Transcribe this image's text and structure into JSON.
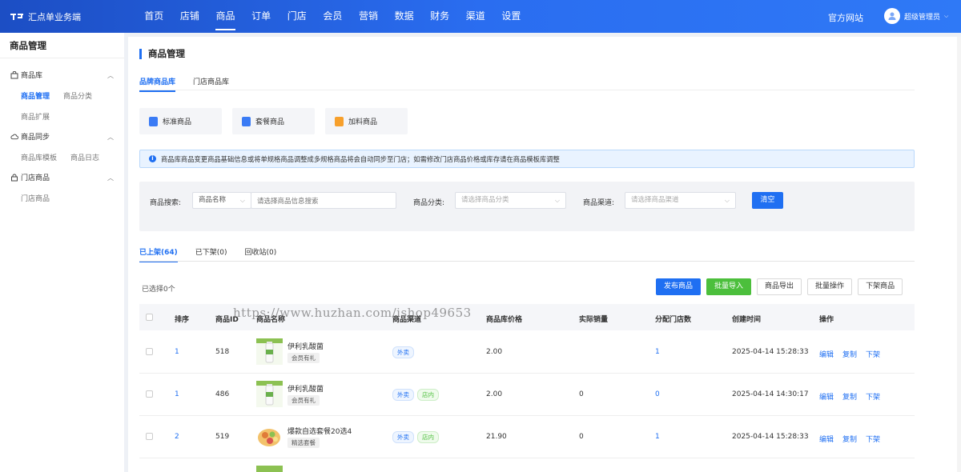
{
  "header": {
    "logo_text": "汇点单业务端",
    "nav": [
      "首页",
      "店铺",
      "商品",
      "订单",
      "门店",
      "会员",
      "营销",
      "数据",
      "财务",
      "渠道",
      "设置"
    ],
    "active_nav": "商品",
    "official_site": "官方网站",
    "user_name": "超级管理员"
  },
  "sidebar": {
    "title": "商品管理",
    "groups": [
      {
        "label": "商品库",
        "icon": "bag-icon",
        "items": [
          "商品管理",
          "商品分类",
          "商品扩展"
        ]
      },
      {
        "label": "商品同步",
        "icon": "cloud-icon",
        "items": [
          "商品库模板",
          "商品日志"
        ]
      },
      {
        "label": "门店商品",
        "icon": "lock-icon",
        "items": [
          "门店商品"
        ]
      }
    ]
  },
  "page": {
    "title": "商品管理",
    "tabs": [
      "品牌商品库",
      "门店商品库"
    ],
    "types": [
      {
        "label": "标准商品",
        "color": "#3a7bf5"
      },
      {
        "label": "套餐商品",
        "color": "#3a7bf5"
      },
      {
        "label": "加料商品",
        "color": "#f7a02c"
      }
    ],
    "notice": "商品库商品变更商品基础信息或将单规格商品调整成多规格商品将会自动同步至门店；如需修改门店商品价格或库存请在商品模板库调整",
    "filter": {
      "search_label": "商品搜索:",
      "search_type": "商品名称",
      "search_placeholder": "请选择商品信息搜索",
      "category_label": "商品分类:",
      "category_placeholder": "请选择商品分类",
      "channel_label": "商品渠道:",
      "channel_placeholder": "请选择商品渠道",
      "clear": "清空"
    },
    "status_tabs": [
      "已上架(64)",
      "已下架(0)",
      "回收站(0)"
    ],
    "selected": "已选择0个",
    "actions": [
      "发布商品",
      "批量导入",
      "商品导出",
      "批量操作",
      "下架商品"
    ]
  },
  "table": {
    "headers": [
      "排序",
      "商品ID",
      "商品名称",
      "商品渠道",
      "商品库价格",
      "实际销量",
      "分配门店数",
      "创建时间",
      "操作"
    ],
    "rows": [
      {
        "sort": "1",
        "id": "518",
        "name": "伊利乳酸菌",
        "tag": "会员有礼",
        "channels": [
          "外卖"
        ],
        "price": "2.00",
        "sales": "",
        "stores": "1",
        "created": "2025-04-14 15:28:33"
      },
      {
        "sort": "1",
        "id": "486",
        "name": "伊利乳酸菌",
        "tag": "会员有礼",
        "channels": [
          "外卖",
          "店内"
        ],
        "price": "2.00",
        "sales": "0",
        "stores": "0",
        "created": "2025-04-14 14:30:17"
      },
      {
        "sort": "2",
        "id": "519",
        "name": "爆款自选套餐20选4",
        "tag": "精选套餐",
        "channels": [
          "外卖",
          "店内"
        ],
        "price": "21.90",
        "sales": "0",
        "stores": "1",
        "created": "2025-04-14 15:28:33"
      }
    ],
    "ops": [
      "编辑",
      "复制",
      "下架"
    ]
  },
  "watermark": "https://www.huzhan.com/ishop49653"
}
